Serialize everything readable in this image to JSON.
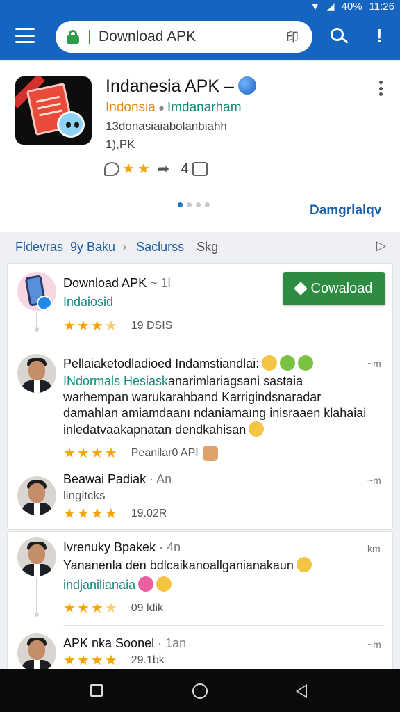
{
  "status_bar": {
    "battery": "40%",
    "time": "11:26"
  },
  "search": {
    "query": "Download APK",
    "aux": "印"
  },
  "app": {
    "title": "Indanesia APK –",
    "developer": "Indonsia",
    "developer_tag": "Imdanarham",
    "meta_line1": "13donasiaiabolanbiahh",
    "meta_line2": "1),PK",
    "rating_count": "4",
    "download_link": "Damgrlalqv"
  },
  "breadcrumb": {
    "items": [
      "Fldevras",
      "9y Baku",
      "Saclurss",
      "Skg"
    ]
  },
  "featured": {
    "title": "Download APK",
    "title_suffix": "~ 1l",
    "subtitle": "Indaiosid",
    "stars": 3.5,
    "stat": "19 DSIS",
    "install_label": "Cowaload"
  },
  "comments": [
    {
      "title": "Pellaiaketodladioed Indamstiandlai:",
      "time": "~m",
      "body_teal": "INdormals Hesiask",
      "body": "anarimlariagsani sastaia warhempan warukarahband Karrigindsnaradar damahlan amiamdaanı ndaniamaıng inisraaen klahaiai inledatvaakapnatan dendkahisan",
      "stars": 4,
      "stat": "Peanilar0 API"
    },
    {
      "title": "Beawai Padiak",
      "title_suffix": "· An",
      "time": "~m",
      "subtitle": "lingitcks",
      "stars": 4,
      "stat": "19.02R"
    },
    {
      "title": "Ivrenuky Bpakek",
      "title_suffix": "· 4n",
      "time": "km",
      "body": "Yananenla den bdlcaikanoallganianakaun",
      "body_teal": "indjanilianaia",
      "stars": 3.5,
      "stat": "09 ldik"
    },
    {
      "title": "APK nka Soonel",
      "title_suffix": "· 1an",
      "time": "~m",
      "stars": 4,
      "stat": "29.1bk"
    }
  ],
  "colors": {
    "appbar": "#1565c0",
    "accent_teal": "#15887a",
    "install_button": "#2e8b42",
    "star": "#f4a400"
  }
}
